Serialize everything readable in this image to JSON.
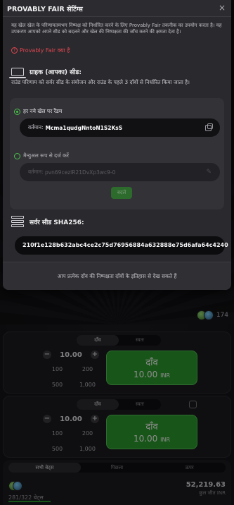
{
  "modal": {
    "title": "PROVABLY FAIR सेटिंग्स",
    "close": "×",
    "intro": "यह खेल खेल के परिणामतमभग निष्पक्ष को निर्धारित करने के लिए Provably Fair तकनीक का उपयोग करता है। यह उपकरण आपको अपने सीड को बदलने और खेल की निष्पक्षता की जाँच करने की क्षमता देता है।",
    "what_link": "Provably Fair क्या है",
    "client_seed": {
      "title": "ग्राहक (आपका) सीड:",
      "subtitle": "राउंड परिणाम को सर्वर सीड के संयोजन और राउंड के पहले 3 दाँवों से निर्धारित किया जाता है।",
      "random_option": "हर नये खेल पर रैंडम",
      "current_label": "वर्तमान:",
      "current_value": "Mcma1qudgNntoN1S2KsS",
      "manual_option": "मैन्युअल रूप से दर्ज करें",
      "manual_label": "वर्तमान:",
      "manual_value": "pvn69cezlR21DvXp3wc9-0",
      "change_button": "बदलें"
    },
    "server_seed": {
      "title": "सर्वर सीड SHA256:",
      "value": "210f1e128b632abc4ce2c75d76956884a632888e75d6afa64c4240"
    },
    "footer": "आप प्रत्येक दाँव की निष्पक्षता दाँवों के इतिहास से देख सकते हैं"
  },
  "game": {
    "players_count": "174",
    "panels": [
      {
        "tab_bet": "दाँव",
        "tab_auto": "स्वतः",
        "amount": "10.00",
        "minus": "−",
        "plus": "+",
        "quick": [
          "100",
          "200",
          "500",
          "1,000"
        ],
        "bet_label": "दाँव",
        "bet_amount": "10.00",
        "currency": "INR"
      },
      {
        "tab_bet": "दाँव",
        "tab_auto": "स्वतः",
        "amount": "10.00",
        "minus": "−",
        "plus": "+",
        "quick": [
          "100",
          "200",
          "500",
          "1,000"
        ],
        "bet_label": "दाँव",
        "bet_amount": "10.00",
        "currency": "INR"
      }
    ],
    "bottom_tabs": [
      "सभी बेट्स",
      "पिछला",
      "ऊपर"
    ],
    "bets_count": "281/322 बेट्स",
    "total_win": "52,219.63",
    "total_win_label": "कुल जीत INR"
  }
}
